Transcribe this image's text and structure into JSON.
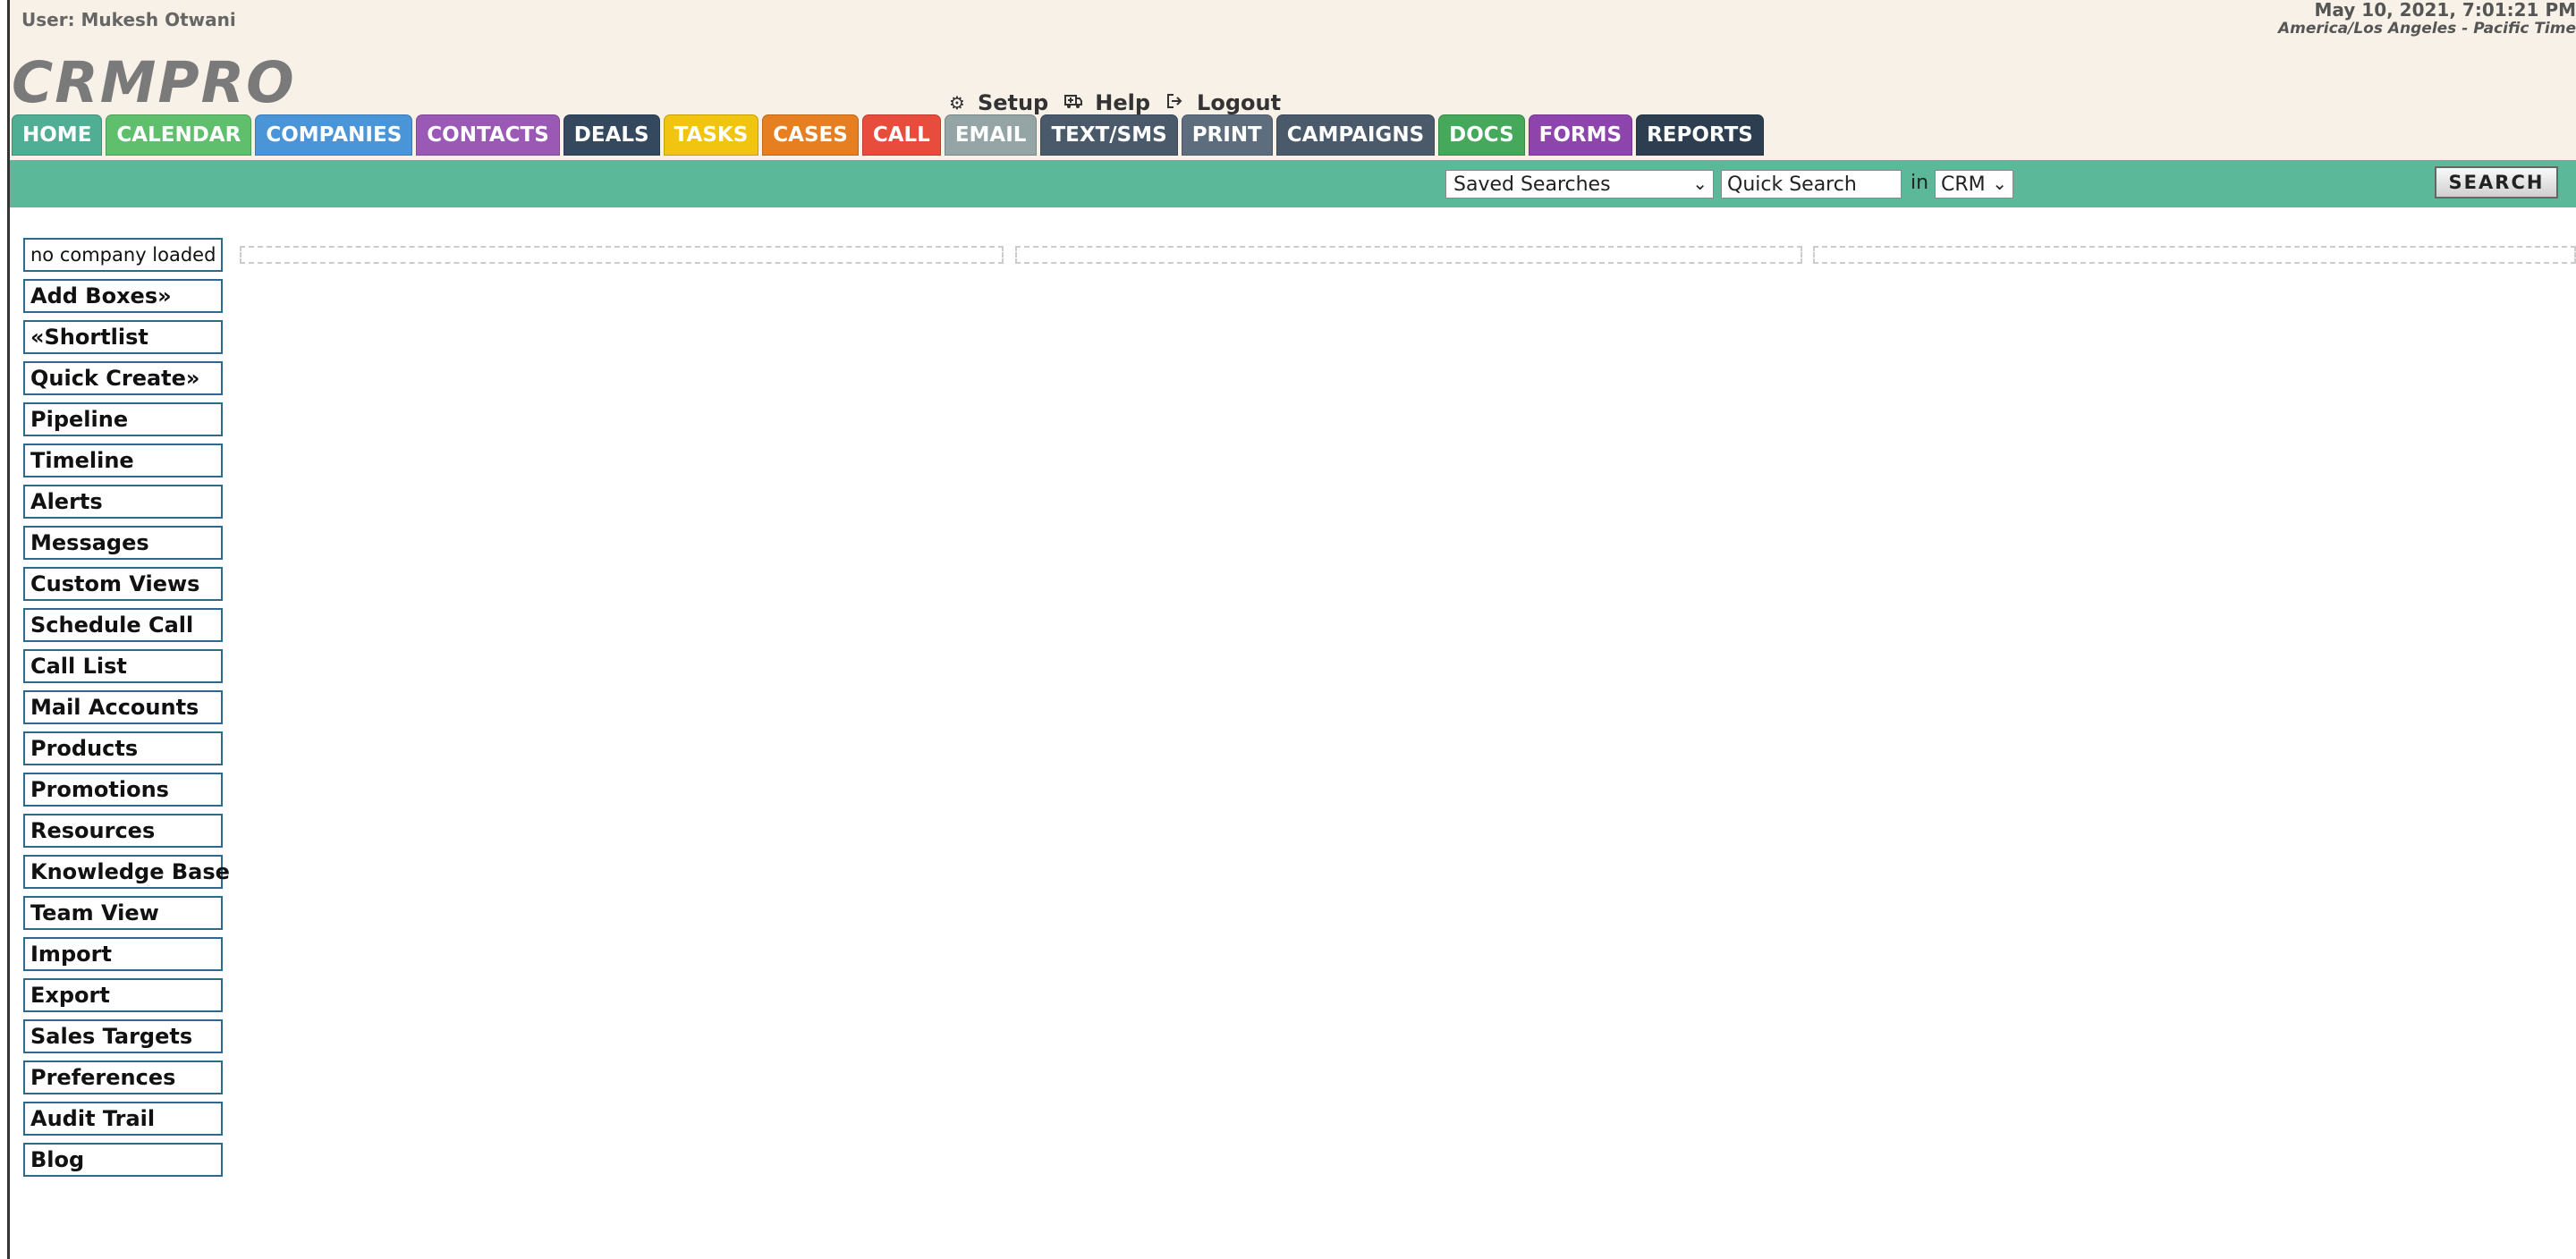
{
  "header": {
    "user_label": "User: Mukesh Otwani",
    "datetime": "May 10, 2021, 7:01:21 PM",
    "timezone": "America/Los Angeles - Pacific Time",
    "logo": "CRMPRO",
    "links": {
      "setup": "Setup",
      "help": "Help",
      "logout": "Logout"
    }
  },
  "nav": {
    "tabs": [
      {
        "label": "HOME",
        "color": "#4fae93"
      },
      {
        "label": "CALENDAR",
        "color": "#5fbf6c"
      },
      {
        "label": "COMPANIES",
        "color": "#4a95d8"
      },
      {
        "label": "CONTACTS",
        "color": "#9b59b6"
      },
      {
        "label": "DEALS",
        "color": "#34495e"
      },
      {
        "label": "TASKS",
        "color": "#f1c40f"
      },
      {
        "label": "CASES",
        "color": "#e67e22"
      },
      {
        "label": "CALL",
        "color": "#e74c3c"
      },
      {
        "label": "EMAIL",
        "color": "#95a5a6"
      },
      {
        "label": "TEXT/SMS",
        "color": "#4a5a6a"
      },
      {
        "label": "PRINT",
        "color": "#5d6d7e"
      },
      {
        "label": "CAMPAIGNS",
        "color": "#4a5a6a"
      },
      {
        "label": "DOCS",
        "color": "#45a85a"
      },
      {
        "label": "FORMS",
        "color": "#8e44ad"
      },
      {
        "label": "REPORTS",
        "color": "#2c3e50"
      }
    ]
  },
  "search": {
    "saved_searches": "Saved Searches",
    "quick_search_value": "Quick Search",
    "in_label": "in",
    "scope": "CRM",
    "button": "SEARCH"
  },
  "sidebar": {
    "no_company": "no company loaded",
    "items": [
      "Add Boxes»",
      "«Shortlist",
      "Quick Create»",
      "Pipeline",
      "Timeline",
      "Alerts",
      "Messages",
      "Custom Views",
      "Schedule Call",
      "Call List",
      "Mail Accounts",
      "Products",
      "Promotions",
      "Resources",
      "Knowledge Base",
      "Team View",
      "Import",
      "Export",
      "Sales Targets",
      "Preferences",
      "Audit Trail",
      "Blog"
    ]
  },
  "icons": {
    "setup": "gears-icon",
    "help": "help-icon",
    "logout": "logout-icon"
  }
}
